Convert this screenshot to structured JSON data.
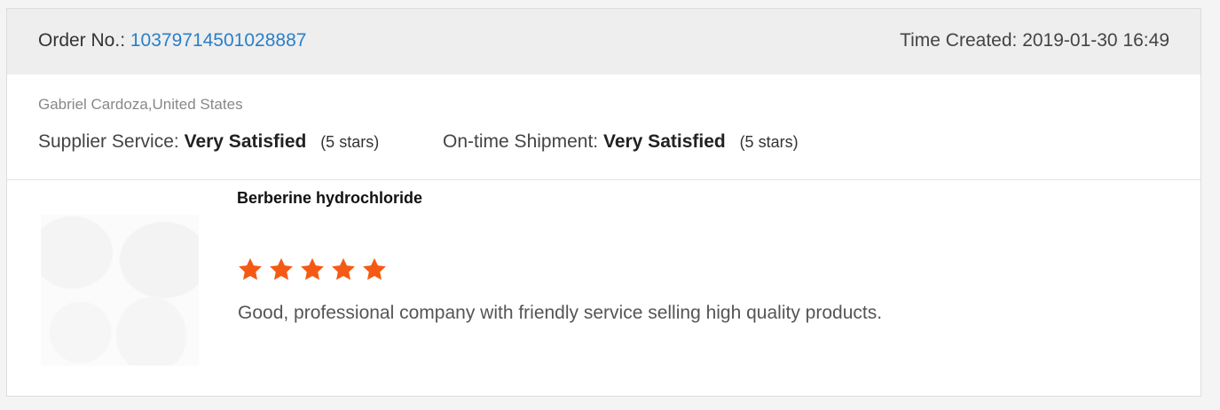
{
  "order": {
    "label": "Order No.:",
    "number": "10379714501028887"
  },
  "time_created": {
    "label": "Time Created:",
    "value": "2019-01-30 16:49"
  },
  "reviewer": "Gabriel Cardoza,United States",
  "ratings": [
    {
      "label": "Supplier Service:",
      "value": "Very Satisfied",
      "stars_text": "(5 stars)"
    },
    {
      "label": "On-time Shipment:",
      "value": "Very Satisfied",
      "stars_text": "(5 stars)"
    }
  ],
  "product": {
    "name": "Berberine hydrochloride",
    "rating": 5,
    "max_rating": 5,
    "review": "Good, professional company with friendly service selling high quality products.",
    "image_icon": "product-photo"
  },
  "colors": {
    "link": "#2a7fc8",
    "star": "#f55a14",
    "header_bg": "#eeeeee"
  }
}
